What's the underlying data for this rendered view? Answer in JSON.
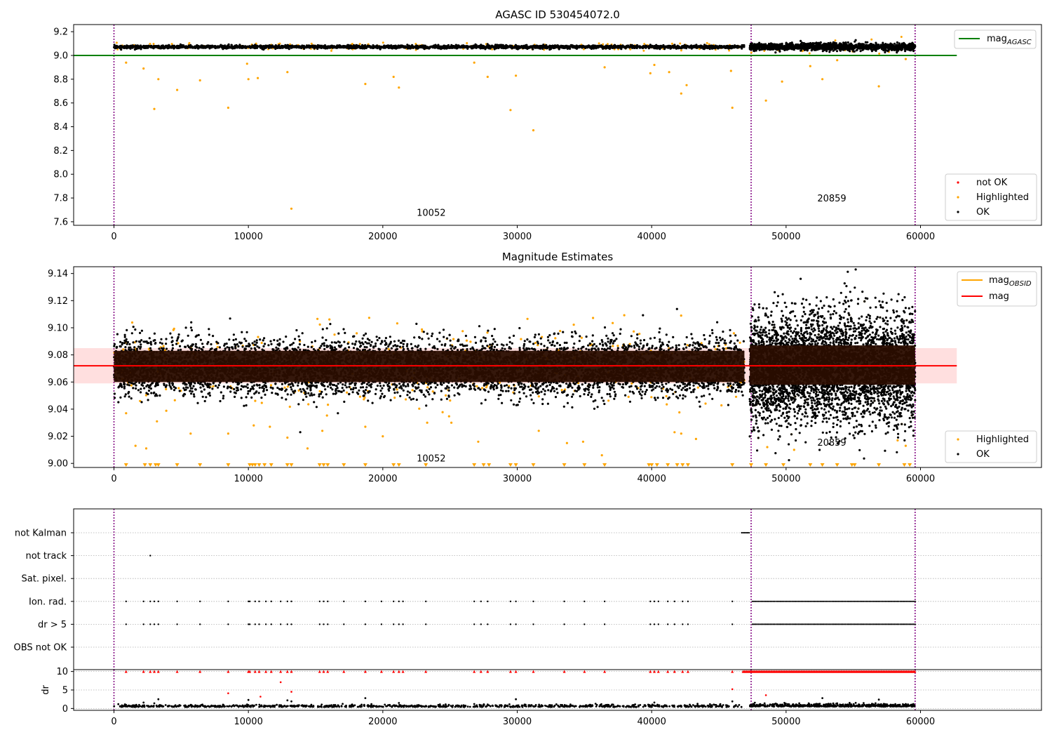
{
  "colors": {
    "ok": "#000000",
    "highlighted": "#ffa500",
    "not_ok": "#ff0000",
    "mag_agasc_line": "#008000",
    "mag_line": "#ff0000",
    "mag_obsid_line": "#ffa500",
    "mag_band": "#ffc0c0",
    "obsid_boundary": "#800080",
    "grid": "#b0b0b0"
  },
  "chart_data": [
    {
      "type": "scatter",
      "title": "AGASC ID 530454072.0",
      "xlim": [
        -3000,
        69000
      ],
      "ylim": [
        7.57,
        9.26
      ],
      "x_ticks": [
        0,
        10000,
        20000,
        30000,
        40000,
        50000,
        60000
      ],
      "y_ticks": [
        7.6,
        7.8,
        8.0,
        8.2,
        8.4,
        8.6,
        8.8,
        9.0,
        9.2
      ],
      "y_tick_labels": [
        "7.6",
        "7.8",
        "8.0",
        "8.2",
        "8.4",
        "8.6",
        "8.8",
        "9.0",
        "9.2"
      ],
      "reference_lines": [
        {
          "name": "mag_AGASC",
          "legend_main": "mag",
          "legend_sub": "AGASC",
          "y": 9.0,
          "x_range": [
            -3000,
            62700
          ]
        }
      ],
      "obsid_boundaries": [
        0,
        47400,
        59600
      ],
      "obsid_labels": [
        {
          "text": "10052",
          "x": 23600,
          "y": 7.65
        },
        {
          "text": "20859",
          "x": 53400,
          "y": 7.77
        }
      ],
      "series": [
        {
          "name": "not OK",
          "segments": []
        },
        {
          "name": "Highlighted",
          "segments": [
            {
              "x_range": [
                0,
                46900
              ],
              "center": 9.075,
              "spread": 0.03,
              "n": 180
            },
            {
              "x_range": [
                47300,
                59500
              ],
              "center": 9.07,
              "spread": 0.06,
              "n": 40
            }
          ],
          "points": [
            [
              900,
              8.94
            ],
            [
              2200,
              8.89
            ],
            [
              3000,
              8.55
            ],
            [
              3300,
              8.8
            ],
            [
              4700,
              8.71
            ],
            [
              6400,
              8.79
            ],
            [
              8500,
              8.56
            ],
            [
              9900,
              8.93
            ],
            [
              10000,
              8.8
            ],
            [
              10700,
              8.81
            ],
            [
              12900,
              8.86
            ],
            [
              13200,
              7.71
            ],
            [
              18700,
              8.76
            ],
            [
              20800,
              8.82
            ],
            [
              21200,
              8.73
            ],
            [
              26800,
              8.94
            ],
            [
              27800,
              8.82
            ],
            [
              29500,
              8.54
            ],
            [
              29900,
              8.83
            ],
            [
              31200,
              8.37
            ],
            [
              36500,
              8.9
            ],
            [
              39900,
              8.85
            ],
            [
              40200,
              8.92
            ],
            [
              41300,
              8.86
            ],
            [
              42200,
              8.68
            ],
            [
              42600,
              8.75
            ],
            [
              46000,
              8.56
            ],
            [
              45900,
              8.87
            ],
            [
              48500,
              8.62
            ],
            [
              49700,
              8.78
            ],
            [
              51800,
              8.91
            ],
            [
              52700,
              8.8
            ],
            [
              53800,
              8.96
            ],
            [
              56900,
              8.74
            ],
            [
              58900,
              8.97
            ]
          ]
        },
        {
          "name": "OK",
          "segments": [
            {
              "x_range": [
                0,
                46900
              ],
              "center": 9.072,
              "spread": 0.013,
              "n": 2600
            },
            {
              "x_range": [
                47300,
                59600
              ],
              "center": 9.072,
              "spread": 0.03,
              "n": 1400
            }
          ]
        }
      ],
      "legend": [
        {
          "marker": "not OK"
        },
        {
          "marker": "Highlighted"
        },
        {
          "marker": "OK"
        }
      ]
    },
    {
      "type": "scatter",
      "title": "Magnitude Estimates",
      "xlim": [
        -3000,
        69000
      ],
      "ylim": [
        8.997,
        9.145
      ],
      "x_ticks": [
        0,
        10000,
        20000,
        30000,
        40000,
        50000,
        60000
      ],
      "y_ticks": [
        9.0,
        9.02,
        9.04,
        9.06,
        9.08,
        9.1,
        9.12,
        9.14
      ],
      "y_tick_labels": [
        "9.00",
        "9.02",
        "9.04",
        "9.06",
        "9.08",
        "9.10",
        "9.12",
        "9.14"
      ],
      "mag_line": {
        "name": "mag",
        "y": 9.072,
        "band": [
          9.059,
          9.085
        ],
        "x_range": [
          -3000,
          62700
        ]
      },
      "mag_obsid": {
        "name": "mag_OBSID",
        "legend_main": "mag",
        "legend_sub": "OBSID"
      },
      "obsid_boundaries": [
        0,
        47400,
        59600
      ],
      "obsid_labels": [
        {
          "text": "10052",
          "x": 23600,
          "y": 9.0015
        },
        {
          "text": "20859",
          "x": 53400,
          "y": 9.013
        }
      ],
      "dense_band": [
        {
          "x_range": [
            0,
            46900
          ],
          "y_range": [
            9.06,
            9.083
          ]
        },
        {
          "x_range": [
            47300,
            59600
          ],
          "y_range": [
            9.058,
            9.087
          ]
        }
      ],
      "series": [
        {
          "name": "Highlighted",
          "segments": [
            {
              "x_range": [
                0,
                46900
              ],
              "center": 9.072,
              "spread": 0.027,
              "n": 420
            },
            {
              "x_range": [
                47300,
                59600
              ],
              "center": 9.07,
              "spread": 0.04,
              "n": 120
            }
          ],
          "points": [
            [
              900,
              9.037
            ],
            [
              1600,
              9.013
            ],
            [
              2400,
              9.011
            ],
            [
              3200,
              9.031
            ],
            [
              5700,
              9.022
            ],
            [
              8500,
              9.022
            ],
            [
              10400,
              9.028
            ],
            [
              11600,
              9.027
            ],
            [
              12900,
              9.019
            ],
            [
              14400,
              9.011
            ],
            [
              15500,
              9.024
            ],
            [
              18700,
              9.027
            ],
            [
              20000,
              9.02
            ],
            [
              23300,
              9.03
            ],
            [
              25100,
              9.03
            ],
            [
              27100,
              9.016
            ],
            [
              31600,
              9.024
            ],
            [
              33700,
              9.015
            ],
            [
              34900,
              9.016
            ],
            [
              36300,
              9.006
            ],
            [
              41700,
              9.023
            ],
            [
              42200,
              9.022
            ],
            [
              43300,
              9.018
            ],
            [
              48600,
              9.012
            ],
            [
              50600,
              9.01
            ],
            [
              58300,
              9.017
            ],
            [
              58900,
              9.013
            ]
          ],
          "clipped_x": [
            900,
            2300,
            2700,
            3100,
            3300,
            4700,
            6400,
            8500,
            10100,
            10300,
            10500,
            10800,
            11200,
            11700,
            12900,
            13200,
            15300,
            15600,
            15900,
            17100,
            18700,
            20800,
            21200,
            23200,
            26800,
            27500,
            27900,
            29500,
            29900,
            31200,
            33500,
            35000,
            36500,
            39800,
            40000,
            40400,
            41200,
            41900,
            42300,
            42700,
            46000,
            47400,
            48500,
            49800,
            51800,
            52700,
            53800,
            54900,
            55100,
            56900,
            58800,
            59200
          ]
        },
        {
          "name": "OK",
          "segments": [
            {
              "x_range": [
                0,
                46900
              ],
              "center": 9.071,
              "spread": 0.02,
              "n": 6500
            },
            {
              "x_range": [
                47300,
                59600
              ],
              "center": 9.07,
              "spread": 0.04,
              "n": 4200
            }
          ]
        }
      ],
      "legend": [
        {
          "line": "mag_OBSID"
        },
        {
          "line": "mag"
        },
        {
          "marker": "Highlighted"
        },
        {
          "marker": "OK"
        }
      ]
    },
    {
      "type": "scatter",
      "title": "",
      "xlim": [
        -3000,
        69000
      ],
      "x_ticks": [
        0,
        10000,
        20000,
        30000,
        40000,
        50000,
        60000
      ],
      "flag_rows": [
        "not Kalman",
        "not track",
        "Sat. pixel.",
        "Ion. rad.",
        "dr > 5",
        "OBS not OK"
      ],
      "flag_points": {
        "not Kalman": {
          "x_ranges": [
            [
              46700,
              47300
            ]
          ]
        },
        "not track": {
          "x_points": [
            2700
          ]
        },
        "Sat. pixel.": {
          "x_points": []
        },
        "Ion. rad.": {
          "x_points": [
            900,
            2200,
            2700,
            3000,
            3300,
            4700,
            6400,
            8500,
            10000,
            10100,
            10500,
            10800,
            11300,
            11700,
            12400,
            12900,
            13200,
            15300,
            15600,
            15900,
            17100,
            18700,
            19900,
            20800,
            21200,
            21500,
            23200,
            26800,
            27300,
            27800,
            29500,
            29900,
            31200,
            33500,
            35000,
            36500,
            39900,
            40200,
            40500,
            41200,
            41700,
            42300,
            42700,
            46000
          ],
          "x_ranges": [
            [
              47500,
              59600
            ]
          ]
        },
        "dr > 5": {
          "x_points": [
            900,
            2200,
            2700,
            3000,
            3300,
            4700,
            6400,
            8500,
            10000,
            10100,
            10500,
            10800,
            11300,
            11700,
            12400,
            12900,
            13200,
            15300,
            15600,
            15900,
            17100,
            18700,
            19900,
            20800,
            21200,
            21500,
            23200,
            26800,
            27300,
            27800,
            29500,
            29900,
            31200,
            33500,
            35000,
            36500,
            39900,
            40200,
            40500,
            41200,
            41700,
            42300,
            42700,
            46000
          ],
          "x_ranges": [
            [
              47500,
              59600
            ]
          ]
        },
        "OBS not OK": {
          "x_points": []
        }
      },
      "obsid_boundaries": [
        0,
        47400,
        59600
      ]
    },
    {
      "type": "scatter",
      "title": "",
      "ylabel": "dr",
      "xlim": [
        -3000,
        69000
      ],
      "ylim": [
        -0.5,
        10.5
      ],
      "y_ticks": [
        0,
        5,
        10
      ],
      "y_tick_labels": [
        "0",
        "5",
        "10"
      ],
      "x_ticks": [
        0,
        10000,
        20000,
        30000,
        40000,
        50000,
        60000
      ],
      "x_tick_labels": [
        "0",
        "10000",
        "20000",
        "30000",
        "40000",
        "50000",
        "60000"
      ],
      "obsid_boundaries": [
        0,
        47400,
        59600
      ],
      "series": [
        {
          "name": "dr > 5",
          "color_key": "not_ok",
          "y_clip": 10,
          "x_points": [
            900,
            2200,
            2700,
            3000,
            3300,
            4700,
            6400,
            8500,
            10000,
            10100,
            10500,
            10800,
            11300,
            11700,
            12400,
            12900,
            13200,
            15300,
            15600,
            15900,
            17100,
            18700,
            19900,
            20800,
            21200,
            21500,
            23200,
            26800,
            27300,
            27800,
            29500,
            29900,
            31200,
            33500,
            35000,
            36500,
            39900,
            40200,
            40500,
            41200,
            41700,
            42300,
            42700,
            46000
          ],
          "x_ranges": [
            [
              46800,
              59600
            ]
          ],
          "points": [
            [
              8500,
              4.1
            ],
            [
              10900,
              3.2
            ],
            [
              12400,
              7.1
            ],
            [
              13200,
              4.5
            ],
            [
              46000,
              5.2
            ],
            [
              48500,
              3.6
            ]
          ]
        },
        {
          "name": "dr",
          "color_key": "ok",
          "segments": [
            {
              "x_range": [
                0,
                46700
              ],
              "center": 0.4,
              "spread": 0.5,
              "n": 900
            },
            {
              "x_range": [
                47300,
                59600
              ],
              "center": 0.5,
              "spread": 0.6,
              "n": 500
            }
          ],
          "points": [
            [
              2200,
              1.6
            ],
            [
              3000,
              1.4
            ],
            [
              3300,
              2.5
            ],
            [
              9900,
              1.1
            ],
            [
              10000,
              2.3
            ],
            [
              12900,
              2.2
            ],
            [
              13200,
              1.9
            ],
            [
              18700,
              2.8
            ],
            [
              21200,
              1.5
            ],
            [
              29900,
              2.5
            ],
            [
              26800,
              1.2
            ],
            [
              27800,
              1.1
            ],
            [
              40200,
              1.6
            ],
            [
              46000,
              1.9
            ],
            [
              52700,
              2.8
            ],
            [
              53800,
              1.4
            ],
            [
              56900,
              2.4
            ],
            [
              58900,
              1.2
            ]
          ]
        }
      ]
    }
  ]
}
